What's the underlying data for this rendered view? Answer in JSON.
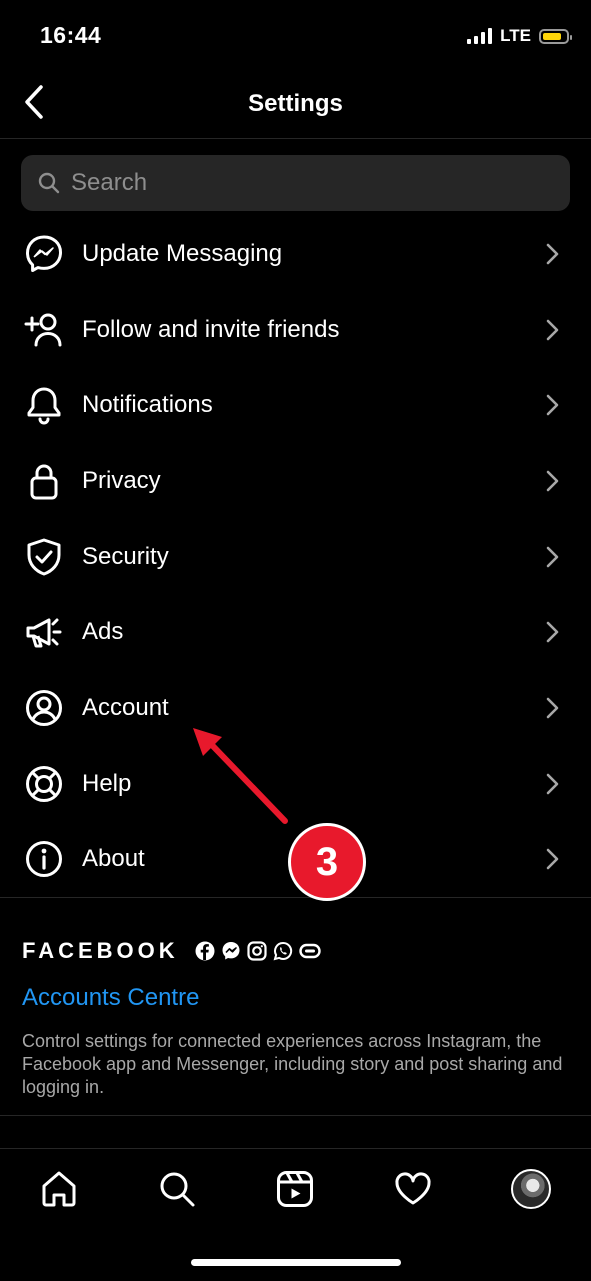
{
  "status_bar": {
    "time": "16:44",
    "network": "LTE",
    "battery_color": "#ffd60a"
  },
  "header": {
    "title": "Settings",
    "back_icon": "chevron-left-icon"
  },
  "search": {
    "placeholder": "Search",
    "value": "",
    "icon": "search-icon"
  },
  "menu": {
    "items": [
      {
        "label": "Update Messaging",
        "icon": "messenger-icon"
      },
      {
        "label": "Follow and invite friends",
        "icon": "add-person-icon"
      },
      {
        "label": "Notifications",
        "icon": "bell-icon"
      },
      {
        "label": "Privacy",
        "icon": "lock-icon"
      },
      {
        "label": "Security",
        "icon": "shield-icon"
      },
      {
        "label": "Ads",
        "icon": "megaphone-icon"
      },
      {
        "label": "Account",
        "icon": "person-circle-icon"
      },
      {
        "label": "Help",
        "icon": "lifebuoy-icon"
      },
      {
        "label": "About",
        "icon": "info-icon"
      }
    ]
  },
  "facebook": {
    "wordmark": "FACEBOOK",
    "icons": [
      "facebook-icon",
      "messenger-icon",
      "instagram-icon",
      "whatsapp-icon",
      "portal-icon"
    ],
    "accounts_centre": "Accounts Centre",
    "description": "Control settings for connected experiences across Instagram, the Facebook app and Messenger, including story and post sharing and logging in.",
    "link_color": "#2196f3"
  },
  "annotation": {
    "badge": "3",
    "color": "#e8192c",
    "target": "Account"
  },
  "tab_bar": {
    "tabs": [
      "home-icon",
      "search-icon",
      "reels-icon",
      "heart-icon",
      "profile-avatar"
    ]
  }
}
